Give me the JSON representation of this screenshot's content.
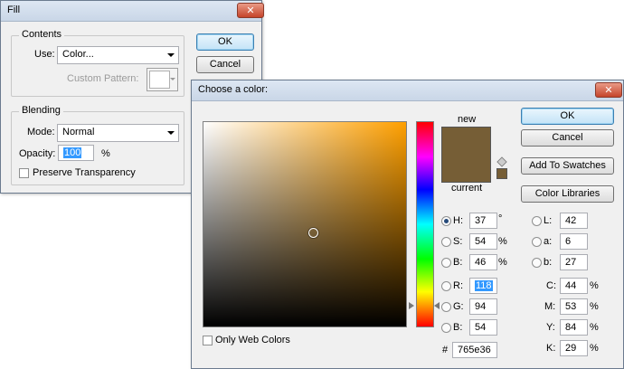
{
  "fill": {
    "title": "Fill",
    "close": "✕",
    "ok": "OK",
    "cancel": "Cancel",
    "contents": {
      "legend": "Contents",
      "use_label": "Use:",
      "use_value": "Color...",
      "custom_pattern_label": "Custom Pattern:"
    },
    "blending": {
      "legend": "Blending",
      "mode_label": "Mode:",
      "mode_value": "Normal",
      "opacity_label": "Opacity:",
      "opacity_value": "100",
      "opacity_unit": "%",
      "preserve_label": "Preserve Transparency"
    }
  },
  "picker": {
    "title": "Choose a color:",
    "close": "✕",
    "ok": "OK",
    "cancel": "Cancel",
    "add_swatches": "Add To Swatches",
    "color_libraries": "Color Libraries",
    "new_label": "new",
    "current_label": "current",
    "new_color": "#765e36",
    "current_color": "#765e36",
    "hue_color": "#ffa000",
    "only_web_label": "Only Web Colors",
    "hsb": [
      {
        "label": "H:",
        "value": "37",
        "unit": "°",
        "selected": true
      },
      {
        "label": "S:",
        "value": "54",
        "unit": "%",
        "selected": false
      },
      {
        "label": "B:",
        "value": "46",
        "unit": "%",
        "selected": false
      }
    ],
    "rgb": [
      {
        "label": "R:",
        "value": "118",
        "selected": false
      },
      {
        "label": "G:",
        "value": "94",
        "selected": false
      },
      {
        "label": "B:",
        "value": "54",
        "selected": false
      }
    ],
    "lab": [
      {
        "label": "L:",
        "value": "42",
        "selected": false
      },
      {
        "label": "a:",
        "value": "6",
        "selected": false
      },
      {
        "label": "b:",
        "value": "27",
        "selected": false
      }
    ],
    "cmyk": [
      {
        "label": "C:",
        "value": "44",
        "unit": "%"
      },
      {
        "label": "M:",
        "value": "53",
        "unit": "%"
      },
      {
        "label": "Y:",
        "value": "84",
        "unit": "%"
      },
      {
        "label": "K:",
        "value": "29",
        "unit": "%"
      }
    ],
    "hex_label": "#",
    "hex_value": "765e36"
  }
}
